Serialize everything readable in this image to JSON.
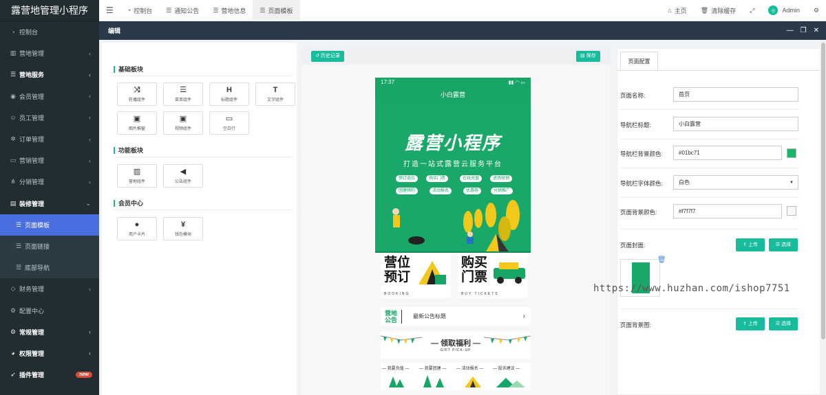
{
  "app_title": "露营地管理小程序",
  "sidebar": {
    "items": [
      {
        "label": "控制台",
        "icon": "dashboard-icon",
        "chev": false,
        "bold": false
      },
      {
        "label": "营地管理",
        "icon": "map-icon",
        "chev": true,
        "bold": false
      },
      {
        "label": "营地服务",
        "icon": "list-icon",
        "chev": true,
        "bold": true
      },
      {
        "label": "会员管理",
        "icon": "user-circle-icon",
        "chev": true,
        "bold": false
      },
      {
        "label": "员工管理",
        "icon": "user-icon",
        "chev": true,
        "bold": false
      },
      {
        "label": "订单管理",
        "icon": "cog-icon",
        "chev": true,
        "bold": false
      },
      {
        "label": "营销管理",
        "icon": "hdd-icon",
        "chev": true,
        "bold": false
      },
      {
        "label": "分销管理",
        "icon": "share-icon",
        "chev": true,
        "bold": false
      },
      {
        "label": "装修管理",
        "icon": "suitcase-icon",
        "chev": true,
        "bold": true
      },
      {
        "label": "页面模板",
        "icon": "list-icon",
        "chev": false,
        "bold": false,
        "sub": true,
        "active": true
      },
      {
        "label": "页面链接",
        "icon": "list-icon",
        "chev": false,
        "bold": false,
        "sub": true
      },
      {
        "label": "底部导航",
        "icon": "list-icon",
        "chev": false,
        "bold": false,
        "sub": true
      },
      {
        "label": "财务管理",
        "icon": "diamond-icon",
        "chev": true,
        "bold": false
      },
      {
        "label": "配置中心",
        "icon": "gear-icon",
        "chev": false,
        "bold": false
      },
      {
        "label": "常规管理",
        "icon": "cogs-icon",
        "chev": true,
        "bold": true
      },
      {
        "label": "权限管理",
        "icon": "group-icon",
        "chev": true,
        "bold": true
      },
      {
        "label": "插件管理",
        "icon": "rocket-icon",
        "chev": false,
        "bold": true,
        "badge": "new"
      }
    ]
  },
  "topbar": {
    "tabs": [
      {
        "label": "控制台",
        "icon": "dashboard-icon"
      },
      {
        "label": "通知公告",
        "icon": "list-icon"
      },
      {
        "label": "营地信息",
        "icon": "list-icon"
      },
      {
        "label": "页面模板",
        "icon": "list-icon",
        "active": true
      }
    ],
    "home": "主页",
    "clear_cache": "清除缓存",
    "admin": "Admin"
  },
  "panel": {
    "title": "编辑"
  },
  "components": {
    "basic_title": "基础板块",
    "basic": [
      {
        "label": "轮播组件",
        "glyph": "⤨"
      },
      {
        "label": "菜单组件",
        "glyph": "☰"
      },
      {
        "label": "标题组件",
        "glyph": "H"
      },
      {
        "label": "文字组件",
        "glyph": "T"
      },
      {
        "label": "图片橱窗",
        "glyph": "▣"
      },
      {
        "label": "视频组件",
        "glyph": "▣"
      },
      {
        "label": "空白行",
        "glyph": "▭"
      }
    ],
    "func_title": "功能板块",
    "func": [
      {
        "label": "营地组件",
        "glyph": "▥"
      },
      {
        "label": "公告组件",
        "glyph": "◀"
      }
    ],
    "member_title": "会员中心",
    "member": [
      {
        "label": "用户卡片",
        "glyph": "●"
      },
      {
        "label": "钱包模块",
        "glyph": "¥"
      }
    ]
  },
  "toolbar": {
    "history": "历史记录",
    "save": "保存"
  },
  "phone": {
    "time": "17:37",
    "nav_title": "小白露营",
    "banner_title": "露营小程序",
    "banner_sub": "打造一站式露营云服务平台",
    "tags": [
      "预订选位",
      "购买门票",
      "在线充值",
      "进场核销",
      "团建预约",
      "活动报名",
      "优惠券",
      "分销推广"
    ],
    "card1_big": "营位\n预订",
    "card1_en": "BOOKING",
    "card2_big": "购买\n门票",
    "card2_en": "BUY TICKETS",
    "notice_tag": "营地\n公告",
    "notice_text": "最新公告标题",
    "gift_title": "— 领取福利 —",
    "gift_sub": "GIFT PICK-UP",
    "bottom": [
      "— 我要充值 —",
      "— 我要团建 —",
      "— 活动报名 —",
      "— 投诉建议 —"
    ]
  },
  "config": {
    "tab": "页面配置",
    "page_name_label": "页面名称:",
    "page_name": "首页",
    "nav_title_label": "导航栏标题:",
    "nav_title": "小白露营",
    "nav_bg_label": "导航栏背景颜色:",
    "nav_bg": "#01bc71",
    "nav_font_label": "导航栏字体颜色:",
    "nav_font": "白色",
    "page_bg_label": "页面背景颜色:",
    "page_bg": "#f7f7f7",
    "cover_label": "页面封面:",
    "bgimg_label": "页面背景图:",
    "upload": "上传",
    "choose": "选择"
  },
  "watermark": "https://www.huzhan.com/ishop7751",
  "colors": {
    "accent": "#18bc9c",
    "brand_green": "#18a566",
    "sidebar": "#222d32",
    "active": "#4a6ee0"
  }
}
